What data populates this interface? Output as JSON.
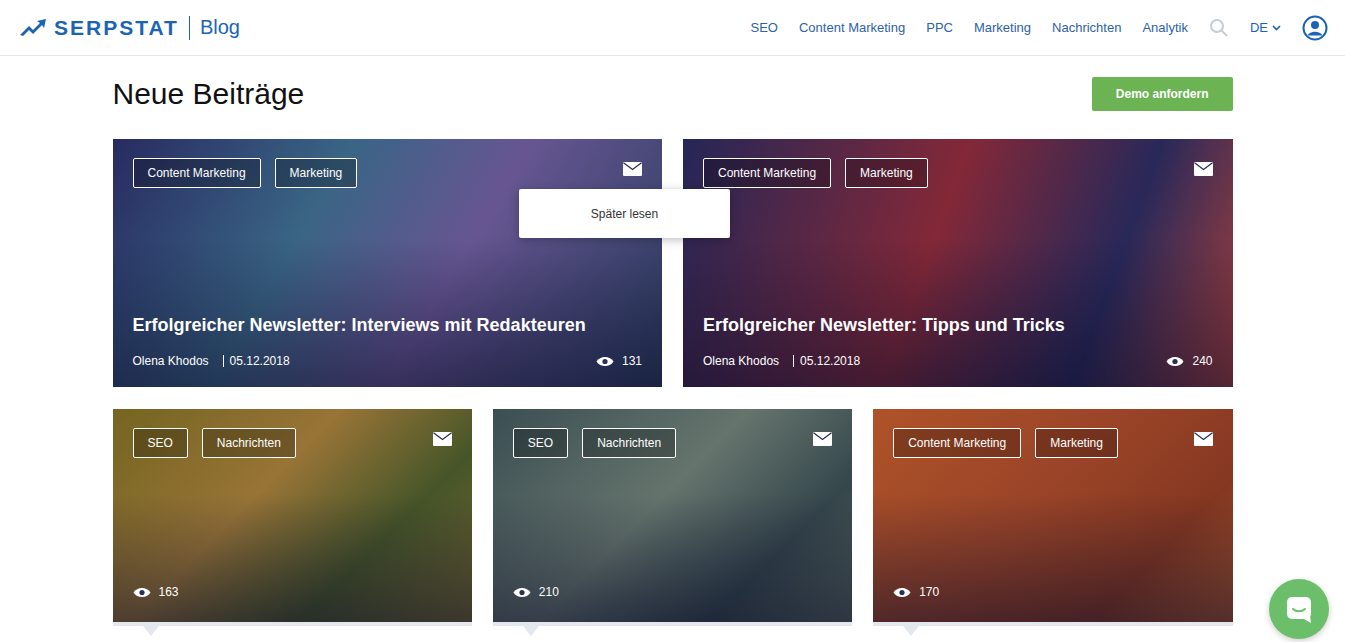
{
  "logo": {
    "brand": "SERPSTAT",
    "section": "Blog"
  },
  "nav": [
    "SEO",
    "Content Marketing",
    "PPC",
    "Marketing",
    "Nachrichten",
    "Analytik"
  ],
  "language": "DE",
  "page_title": "Neue Beiträge",
  "demo_button": "Demo anfordern",
  "read_later_label": "Später lesen",
  "featured": [
    {
      "tags": [
        "Content Marketing",
        "Marketing"
      ],
      "title": "Erfolgreicher Newsletter: Interviews mit Redakteuren",
      "author": "Olena Khodos",
      "date": "05.12.2018",
      "views": "131",
      "menu_open": true
    },
    {
      "tags": [
        "Content Marketing",
        "Marketing"
      ],
      "title": "Erfolgreicher Newsletter: Tipps und Tricks",
      "author": "Olena Khodos",
      "date": "05.12.2018",
      "views": "240",
      "menu_open": false
    }
  ],
  "posts": [
    {
      "tags": [
        "SEO",
        "Nachrichten"
      ],
      "views": "163",
      "menu_open": false
    },
    {
      "tags": [
        "SEO",
        "Nachrichten"
      ],
      "views": "210",
      "menu_open": false
    },
    {
      "tags": [
        "Content Marketing",
        "Marketing"
      ],
      "views": "170",
      "menu_open": false
    }
  ]
}
